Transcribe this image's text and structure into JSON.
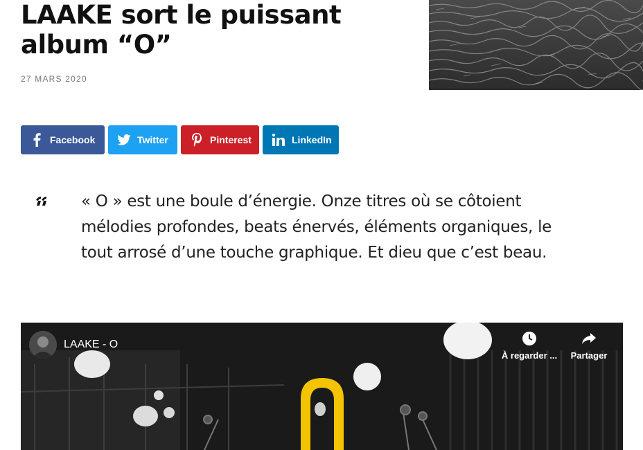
{
  "article": {
    "title": "LAAKE sort le puissant album “O”",
    "date": "27 MARS 2020"
  },
  "share": {
    "facebook": "Facebook",
    "twitter": "Twitter",
    "pinterest": "Pinterest",
    "linkedin": "LinkedIn"
  },
  "quote": {
    "text": "« O » est une boule d’énergie. Onze titres où se côtoient mélodies profondes, beats énervés, éléments organiques, le tout arrosé d’une touche graphique. Et dieu que c’est beau."
  },
  "video": {
    "title": "LAAKE - O",
    "watch_later": "À regarder ...",
    "share": "Partager"
  },
  "colors": {
    "facebook": "#3b5998",
    "twitter": "#1da1f2",
    "pinterest": "#cb2027",
    "linkedin": "#0077b5",
    "accent_yellow": "#f5c400"
  }
}
